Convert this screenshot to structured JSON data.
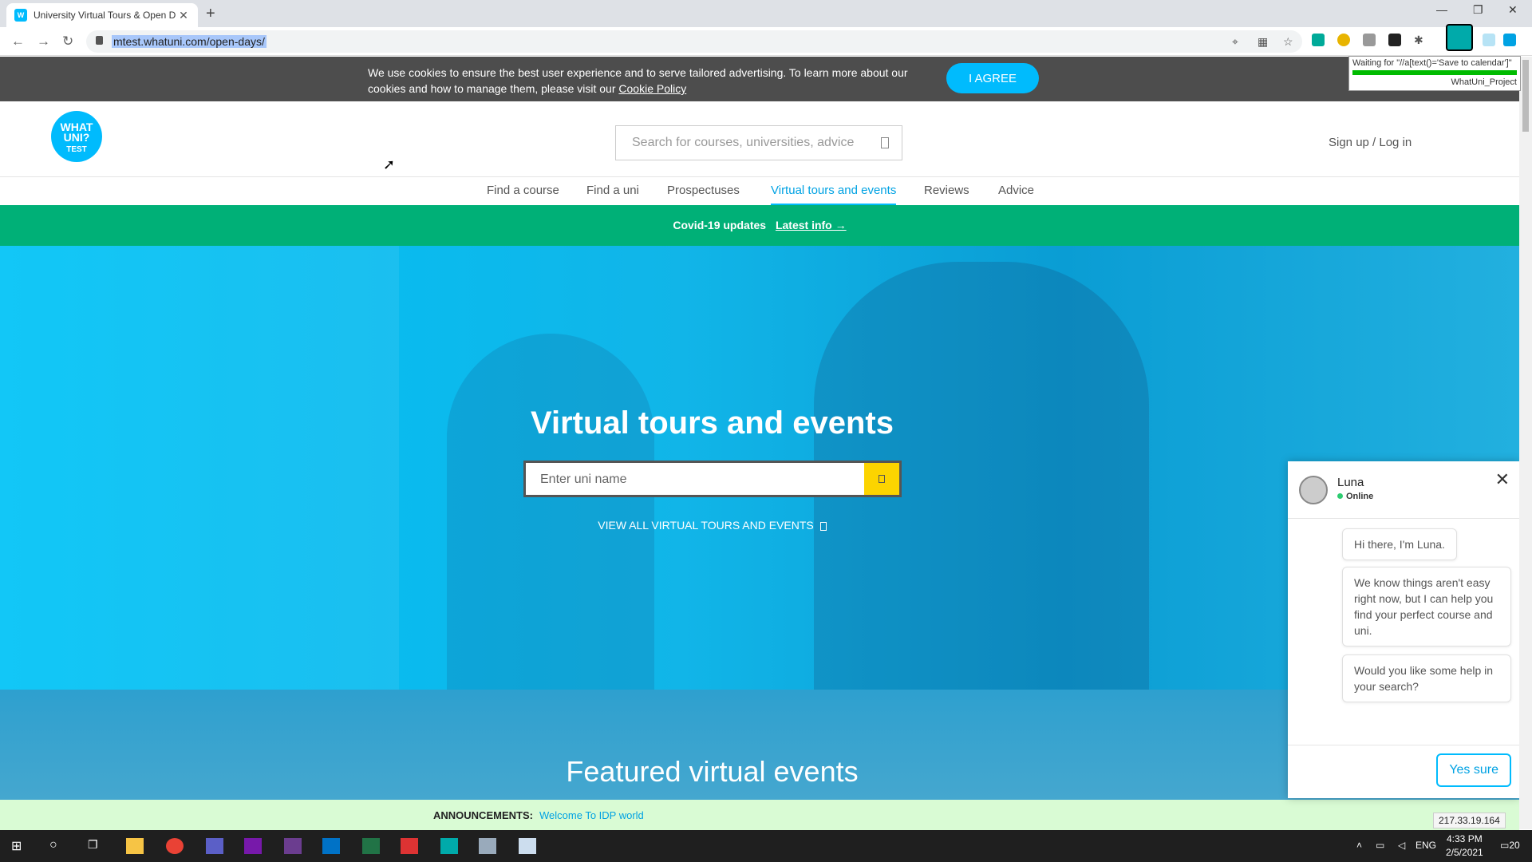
{
  "browser": {
    "tab_title": "University Virtual Tours & Open D",
    "tab_favicon": "W",
    "url": "mtest.whatuni.com/open-days/",
    "tooltip_waiting": "Waiting for \"//a[text()='Save to calendar']\"",
    "tooltip_project": "WhatUni_Project"
  },
  "cookie": {
    "text": "We use cookies to ensure the best user experience and to serve tailored advertising. To learn more about our cookies and how to manage them, please visit our ",
    "link": "Cookie Policy",
    "agree_label": "I AGREE"
  },
  "header": {
    "logo_line1": "WHAT",
    "logo_line2": "UNI?",
    "logo_line3": "TEST",
    "search_placeholder": "Search for courses, universities, advice",
    "signin": "Sign up / Log in"
  },
  "nav": {
    "items": [
      "Find a course",
      "Find a uni",
      "Prospectuses",
      "Virtual tours and events",
      "Reviews",
      "Advice"
    ]
  },
  "covid": {
    "label": "Covid-19 updates",
    "link": "Latest info →"
  },
  "hero": {
    "title": "Virtual tours and events",
    "uni_placeholder": "Enter uni name",
    "view_all": "VIEW ALL VIRTUAL TOURS AND EVENTS"
  },
  "featured": {
    "title": "Featured virtual events"
  },
  "announcement": {
    "label": "ANNOUNCEMENTS:",
    "message": "Welcome To IDP world",
    "ip": "217.33.19.164"
  },
  "chat": {
    "name": "Luna",
    "status": "Online",
    "messages": [
      "Hi there, I'm Luna.",
      "We know things aren't easy right now, but I can help you find your perfect course and uni.",
      "Would you like some help in your search?"
    ],
    "reply_label": "Yes sure"
  },
  "taskbar": {
    "lang": "ENG",
    "time": "4:33 PM",
    "date": "2/5/2021",
    "notif_count": "20"
  },
  "colors": {
    "brand_blue": "#00bbfd",
    "covid_green": "#00b077",
    "search_yellow": "#fcd400"
  }
}
